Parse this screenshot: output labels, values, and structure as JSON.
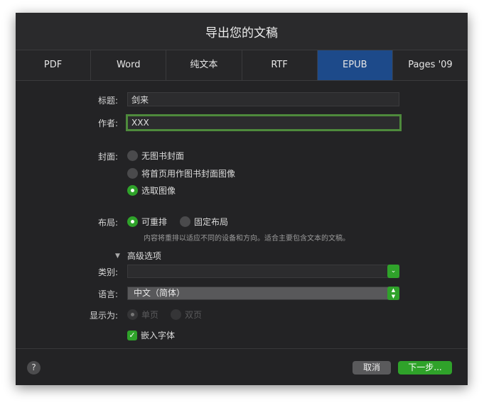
{
  "window": {
    "title": "导出您的文稿"
  },
  "tabs": [
    "PDF",
    "Word",
    "纯文本",
    "RTF",
    "EPUB",
    "Pages '09"
  ],
  "form": {
    "title_label": "标题:",
    "title_value": "剑来",
    "author_label": "作者:",
    "author_value": "XXX",
    "cover_label": "封面:",
    "cover_options": [
      "无图书封面",
      "将首页用作图书封面图像",
      "选取图像"
    ],
    "layout_label": "布局:",
    "layout_options": [
      "可重排",
      "固定布局"
    ],
    "layout_hint": "内容将重排以适应不同的设备和方向。适合主要包含文本的文稿。",
    "advanced_label": "高级选项",
    "category_label": "类别:",
    "category_value": "",
    "language_label": "语言:",
    "language_value": "中文（简体）",
    "display_label": "显示为:",
    "display_options": [
      "单页",
      "双页"
    ],
    "embed_fonts_label": "嵌入字体"
  },
  "footer": {
    "help": "?",
    "cancel": "取消",
    "next": "下一步..."
  },
  "colors": {
    "accent": "#2fa22a",
    "selected_tab": "#1d4a8a"
  }
}
